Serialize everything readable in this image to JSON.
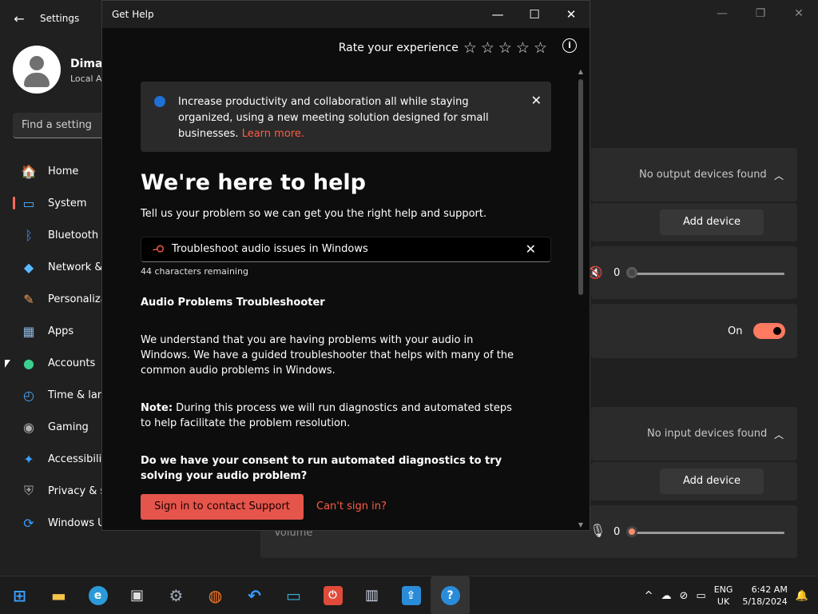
{
  "settings": {
    "title": "Settings",
    "back_glyph": "←",
    "window_controls": [
      "—",
      "❐",
      "✕"
    ],
    "profile_name": "Dimas",
    "profile_sub": "Local A",
    "find_placeholder": "Find a setting",
    "nav": [
      {
        "label": "Home",
        "icon": "🏠",
        "color": "#f3a87a"
      },
      {
        "label": "System",
        "icon": "▭",
        "color": "#4ab0ff"
      },
      {
        "label": "Bluetooth &",
        "icon": "ᛒ",
        "color": "#3a8cff"
      },
      {
        "label": "Network &",
        "icon": "◆",
        "color": "#5ab8ff"
      },
      {
        "label": "Personaliza",
        "icon": "✎",
        "color": "#f0a060"
      },
      {
        "label": "Apps",
        "icon": "▦",
        "color": "#8ab4e0"
      },
      {
        "label": "Accounts",
        "icon": "●",
        "color": "#3ccf8e"
      },
      {
        "label": "Time & lan",
        "icon": "◴",
        "color": "#4aa8ff"
      },
      {
        "label": "Gaming",
        "icon": "◉",
        "color": "#b0b0b0"
      },
      {
        "label": "Accessibilit",
        "icon": "✦",
        "color": "#3aa0ff"
      },
      {
        "label": "Privacy & s",
        "icon": "⛨",
        "color": "#a0a0a0"
      },
      {
        "label": "Windows U",
        "icon": "⟳",
        "color": "#3a9cff"
      }
    ],
    "output": {
      "status": "No output devices found",
      "add_device": "Add device",
      "volume": "0"
    },
    "toggle_label": "On",
    "input": {
      "status": "No input devices found",
      "add_device": "Add device",
      "volume": "0"
    },
    "volume_label": "Volume"
  },
  "gethelp": {
    "title": "Get Help",
    "window_controls": [
      "—",
      "☐",
      "✕"
    ],
    "rate_label": "Rate your experience",
    "stars": "☆☆☆☆☆",
    "info": "i",
    "banner_text": "Increase productivity and collaboration all while staying organized, using a new meeting solution designed for small businesses. ",
    "banner_link": "Learn more.",
    "banner_close": "✕",
    "heading": "We're here to help",
    "subheading": "Tell us your problem so we can get you the right help and support.",
    "search_value": "Troubleshoot audio issues in Windows",
    "search_clear": "✕",
    "chars_remaining": "44 characters remaining",
    "result_title": "Audio Problems Troubleshooter",
    "para1": "We understand that you are having problems with your audio in Windows. We have a guided troubleshooter that helps with many of the common audio problems in Windows.",
    "note_label": "Note:",
    "note_text": " During this process we will run diagnostics and automated steps to help facilitate the problem resolution.",
    "question": "Do we have your consent to run automated diagnostics to try solving your audio problem?",
    "sign_in_button": "Sign in to contact Support",
    "cant_sign_in": "Can't sign in?"
  },
  "taskbar": {
    "apps": [
      {
        "name": "start",
        "glyph": "⊞",
        "color": "#3aa0ff"
      },
      {
        "name": "file-explorer",
        "glyph": "▬",
        "color": "#f3c34a"
      },
      {
        "name": "edge",
        "glyph": "e",
        "color": "#2a9ad8"
      },
      {
        "name": "store",
        "glyph": "▣",
        "color": "#e0e0e0"
      },
      {
        "name": "settings",
        "glyph": "⚙",
        "color": "#a0a8b8"
      },
      {
        "name": "firefox",
        "glyph": "◍",
        "color": "#ff7a2a"
      },
      {
        "name": "undo-app",
        "glyph": "↶",
        "color": "#3a9cff"
      },
      {
        "name": "display-app",
        "glyph": "▭",
        "color": "#3ab0d8"
      },
      {
        "name": "power-app",
        "glyph": "⏻",
        "color": "#e04a3a"
      },
      {
        "name": "book-app",
        "glyph": "▥",
        "color": "#d0d8e8"
      },
      {
        "name": "tool-app",
        "glyph": "⇧",
        "color": "#2a8cd8"
      },
      {
        "name": "get-help",
        "glyph": "?",
        "color": "#2a8cd8"
      }
    ],
    "tray_icons": [
      "^",
      "☁",
      "⊘",
      "▭"
    ],
    "lang_top": "ENG",
    "lang_bottom": "UK",
    "time": "6:42 AM",
    "date": "5/18/2024",
    "bell": "🔔"
  }
}
